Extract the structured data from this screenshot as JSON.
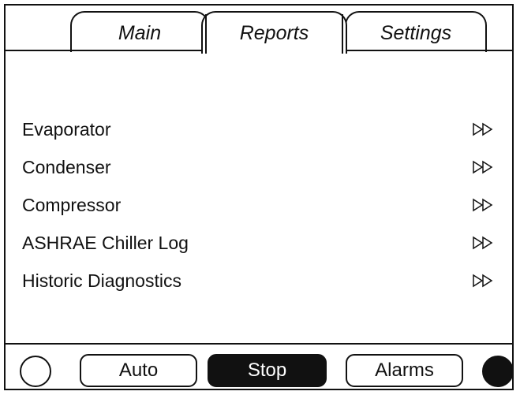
{
  "tabs": [
    {
      "label": "Main",
      "active": false
    },
    {
      "label": "Reports",
      "active": true
    },
    {
      "label": "Settings",
      "active": false
    }
  ],
  "menu": {
    "items": [
      {
        "label": "Evaporator",
        "icon": "double-right-arrow-icon"
      },
      {
        "label": "Condenser",
        "icon": "double-right-arrow-icon"
      },
      {
        "label": "Compressor",
        "icon": "double-right-arrow-icon"
      },
      {
        "label": "ASHRAE Chiller Log",
        "icon": "double-right-arrow-icon"
      },
      {
        "label": "Historic Diagnostics",
        "icon": "double-right-arrow-icon"
      }
    ]
  },
  "footer": {
    "auto_label": "Auto",
    "stop_label": "Stop",
    "alarms_label": "Alarms",
    "left_indicator": "open-circle-icon",
    "right_indicator": "filled-circle-icon"
  },
  "colors": {
    "foreground": "#111111",
    "background": "#ffffff"
  }
}
